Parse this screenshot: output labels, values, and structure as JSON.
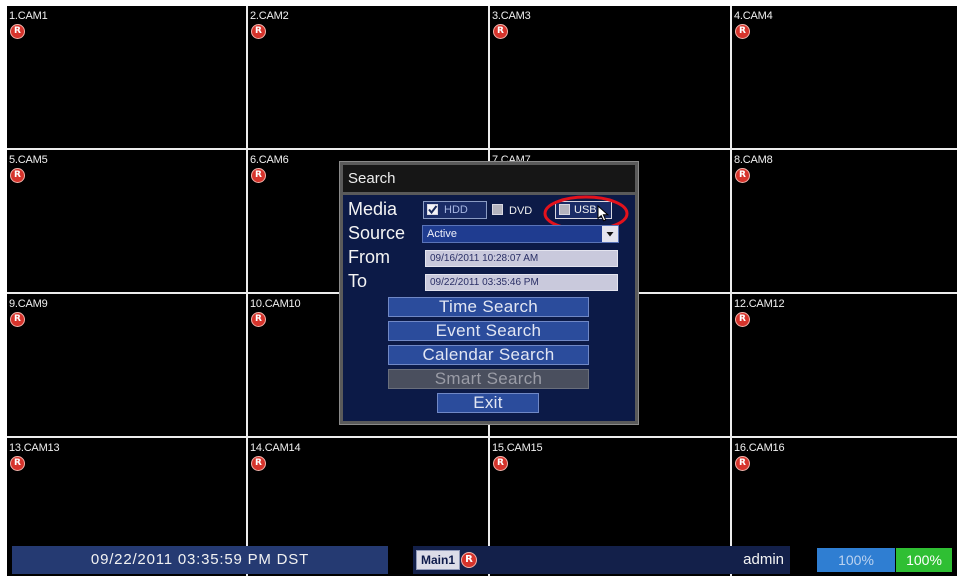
{
  "screen": {
    "rec_icon_letter": "R",
    "tiles": [
      {
        "label": "1.CAM1",
        "recording": true
      },
      {
        "label": "2.CAM2",
        "recording": true
      },
      {
        "label": "3.CAM3",
        "recording": true
      },
      {
        "label": "4.CAM4",
        "recording": true
      },
      {
        "label": "5.CAM5",
        "recording": true
      },
      {
        "label": "6.CAM6",
        "recording": true
      },
      {
        "label": "7.CAM7",
        "recording": false
      },
      {
        "label": "8.CAM8",
        "recording": true
      },
      {
        "label": "9.CAM9",
        "recording": true
      },
      {
        "label": "10.CAM10",
        "recording": true
      },
      {
        "label": "",
        "recording": false
      },
      {
        "label": "12.CAM12",
        "recording": true
      },
      {
        "label": "13.CAM13",
        "recording": true
      },
      {
        "label": "14.CAM14",
        "recording": true
      },
      {
        "label": "15.CAM15",
        "recording": true
      },
      {
        "label": "16.CAM16",
        "recording": true
      }
    ]
  },
  "search_dialog": {
    "title": "Search",
    "media_label": "Media",
    "source_label": "Source",
    "from_label": "From",
    "to_label": "To",
    "media_options": [
      {
        "label": "HDD",
        "checked": true
      },
      {
        "label": "DVD",
        "checked": false
      },
      {
        "label": "USB",
        "checked": false
      }
    ],
    "source_value": "Active",
    "from_value": "09/16/2011 10:28:07 AM",
    "to_value": "09/22/2011 03:35:46 PM",
    "buttons": [
      {
        "label": "Time Search",
        "enabled": true
      },
      {
        "label": "Event Search",
        "enabled": true
      },
      {
        "label": "Calendar Search",
        "enabled": true
      },
      {
        "label": "Smart Search",
        "enabled": false
      },
      {
        "label": "Exit",
        "enabled": true
      }
    ]
  },
  "status_bar": {
    "datetime": "09/22/2011 03:35:59 PM DST",
    "display_mode": "Main1",
    "user": "admin",
    "storage_blue": "100%",
    "storage_green": "100%"
  },
  "colors": {
    "recording_red": "#d6342c",
    "highlight_red": "#e3121c",
    "dialog_body": "#0c1a47",
    "button_blue": "#2b4c9c",
    "storage_blue": "#2f7ed2",
    "storage_green": "#2fbf33"
  }
}
